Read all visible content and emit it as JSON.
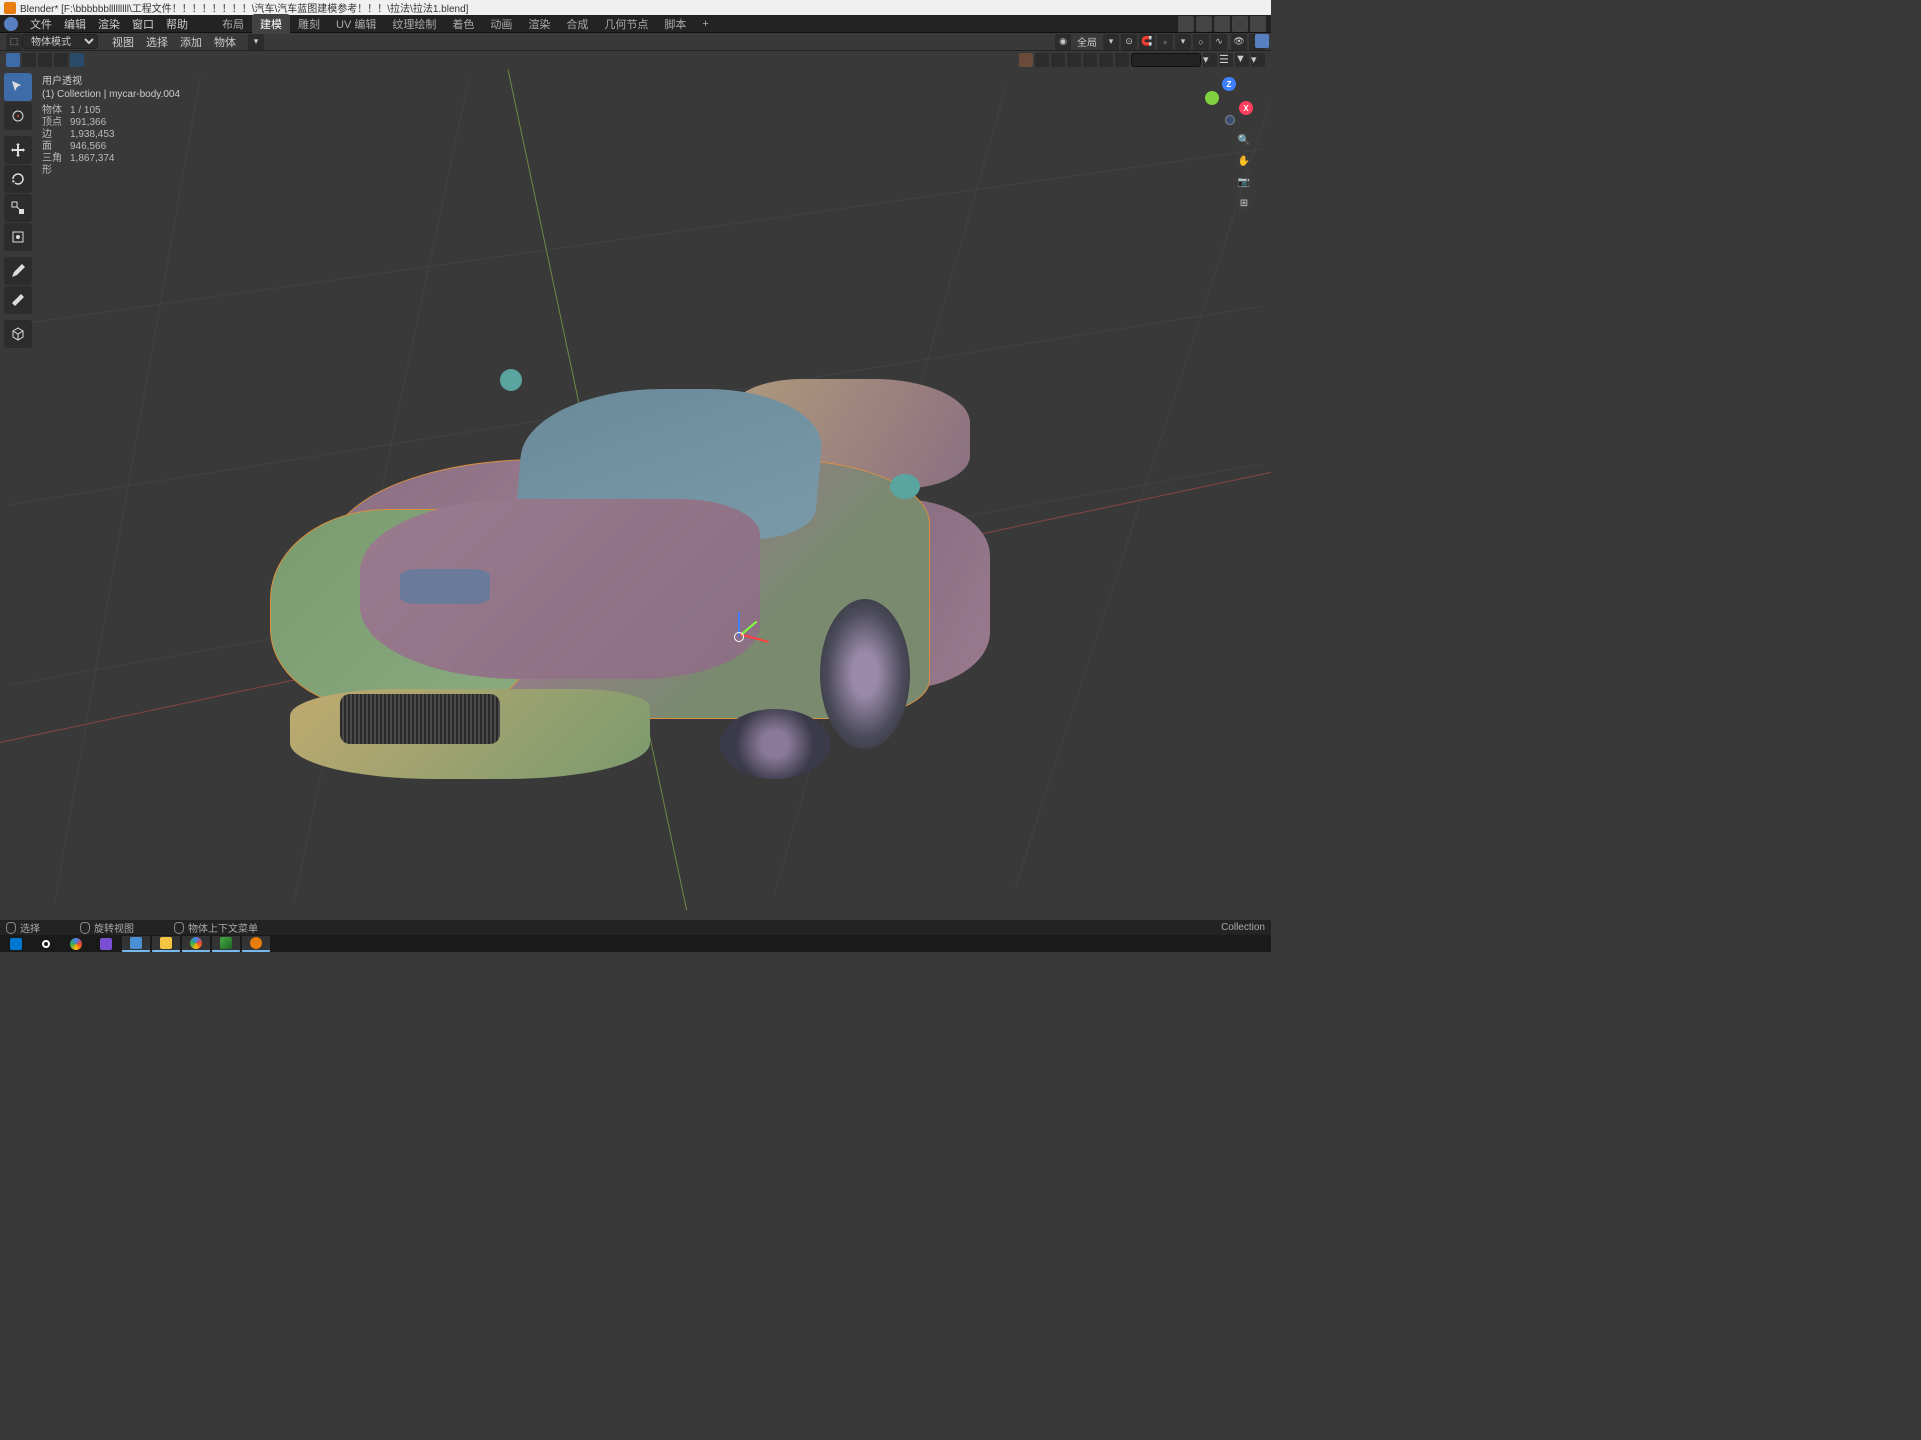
{
  "window_title": "Blender* [F:\\bbbbbblllllllll\\工程文件！！！！！！！！\\汽车\\汽车蓝图建模参考！！！\\拉法\\拉法1.blend]",
  "top_menu": {
    "file": "文件",
    "edit": "编辑",
    "render": "渲染",
    "window": "窗口",
    "help": "帮助"
  },
  "workspaces": {
    "layout": "布局",
    "modeling": "建模",
    "sculpting": "雕刻",
    "uv": "UV 编辑",
    "texture": "纹理绘制",
    "shading": "着色",
    "animation": "动画",
    "rendering": "渲染",
    "compositing": "合成",
    "geometry": "几何节点",
    "scripting": "脚本",
    "add": "+"
  },
  "header": {
    "mode": "物体模式",
    "view": "视图",
    "select": "选择",
    "add": "添加",
    "object": "物体",
    "global": "全局"
  },
  "overlay": {
    "perspective": "用户透视",
    "collection": "(1) Collection | mycar-body.004"
  },
  "stats": {
    "object_label": "物体",
    "object_val": "1 / 105",
    "verts_label": "顶点",
    "verts_val": "991,366",
    "edges_label": "边",
    "edges_val": "1,938,453",
    "faces_label": "面",
    "faces_val": "946,566",
    "tris_label": "三角形",
    "tris_val": "1,867,374"
  },
  "nav_axes": {
    "z": "Z",
    "x": "X",
    "y": ""
  },
  "status": {
    "select": "选择",
    "rotate": "旋转视图",
    "context": "物体上下文菜单",
    "collection": "Collection"
  }
}
